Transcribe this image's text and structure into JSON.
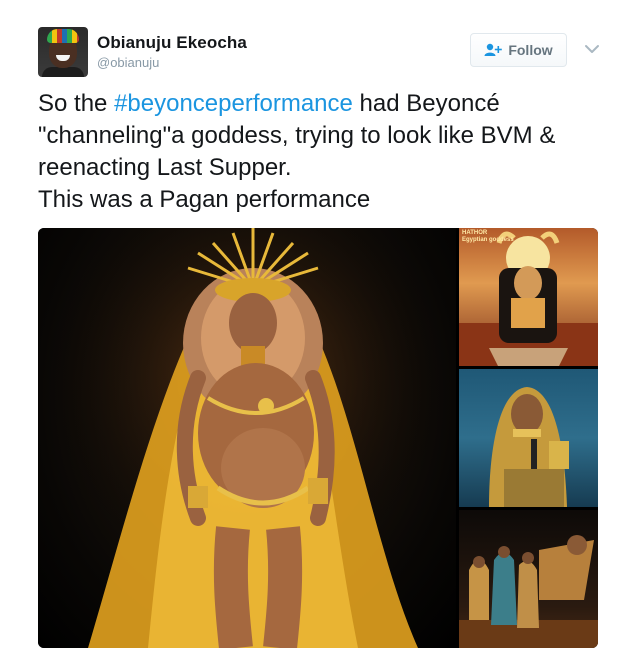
{
  "user": {
    "name": "Obianuju Ekeocha",
    "handle": "@obianuju",
    "avatar_icon": "avatar"
  },
  "actions": {
    "follow_label": "Follow",
    "follow_icon": "add-user-icon",
    "menu_icon": "chevron-down-icon"
  },
  "tweet": {
    "line1_prefix": "So the ",
    "hashtag": "#beyonceperformance",
    "line1_suffix": " had Beyoncé",
    "line2": "\"channeling\"a goddess, trying to look like BVM &",
    "line3": "reenacting Last Supper.",
    "line4": "This was a Pagan performance"
  },
  "media": {
    "thumb1_caption_line1": "HATHOR",
    "thumb1_caption_line2": "Egyptian goddess"
  },
  "colors": {
    "hashtag": "#1b95e0",
    "text": "#14171a",
    "secondary": "#8899a6",
    "button_text": "#66757f"
  }
}
